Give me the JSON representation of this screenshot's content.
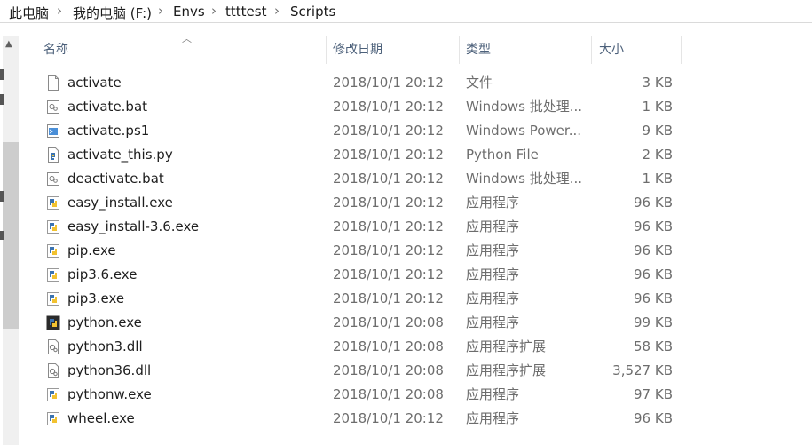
{
  "breadcrumb": [
    {
      "label": "此电脑"
    },
    {
      "label": "我的电脑 (F:)"
    },
    {
      "label": "Envs"
    },
    {
      "label": "ttttest"
    },
    {
      "label": "Scripts"
    }
  ],
  "columns": {
    "name": "名称",
    "date": "修改日期",
    "type": "类型",
    "size": "大小"
  },
  "files": [
    {
      "name": "activate",
      "date": "2018/10/1 20:12",
      "type": "文件",
      "size": "3 KB",
      "icon": "blank-file-icon"
    },
    {
      "name": "activate.bat",
      "date": "2018/10/1 20:12",
      "type": "Windows 批处理...",
      "size": "1 KB",
      "icon": "batch-file-icon"
    },
    {
      "name": "activate.ps1",
      "date": "2018/10/1 20:12",
      "type": "Windows Power...",
      "size": "9 KB",
      "icon": "powershell-file-icon"
    },
    {
      "name": "activate_this.py",
      "date": "2018/10/1 20:12",
      "type": "Python File",
      "size": "2 KB",
      "icon": "python-file-icon"
    },
    {
      "name": "deactivate.bat",
      "date": "2018/10/1 20:12",
      "type": "Windows 批处理...",
      "size": "1 KB",
      "icon": "batch-file-icon"
    },
    {
      "name": "easy_install.exe",
      "date": "2018/10/1 20:12",
      "type": "应用程序",
      "size": "96 KB",
      "icon": "python-exe-icon"
    },
    {
      "name": "easy_install-3.6.exe",
      "date": "2018/10/1 20:12",
      "type": "应用程序",
      "size": "96 KB",
      "icon": "python-exe-icon"
    },
    {
      "name": "pip.exe",
      "date": "2018/10/1 20:12",
      "type": "应用程序",
      "size": "96 KB",
      "icon": "python-exe-icon"
    },
    {
      "name": "pip3.6.exe",
      "date": "2018/10/1 20:12",
      "type": "应用程序",
      "size": "96 KB",
      "icon": "python-exe-icon"
    },
    {
      "name": "pip3.exe",
      "date": "2018/10/1 20:12",
      "type": "应用程序",
      "size": "96 KB",
      "icon": "python-exe-icon"
    },
    {
      "name": "python.exe",
      "date": "2018/10/1 20:08",
      "type": "应用程序",
      "size": "99 KB",
      "icon": "python-console-icon"
    },
    {
      "name": "python3.dll",
      "date": "2018/10/1 20:08",
      "type": "应用程序扩展",
      "size": "58 KB",
      "icon": "dll-file-icon"
    },
    {
      "name": "python36.dll",
      "date": "2018/10/1 20:08",
      "type": "应用程序扩展",
      "size": "3,527 KB",
      "icon": "dll-file-icon"
    },
    {
      "name": "pythonw.exe",
      "date": "2018/10/1 20:08",
      "type": "应用程序",
      "size": "97 KB",
      "icon": "python-exe-icon"
    },
    {
      "name": "wheel.exe",
      "date": "2018/10/1 20:12",
      "type": "应用程序",
      "size": "96 KB",
      "icon": "python-exe-icon"
    }
  ]
}
